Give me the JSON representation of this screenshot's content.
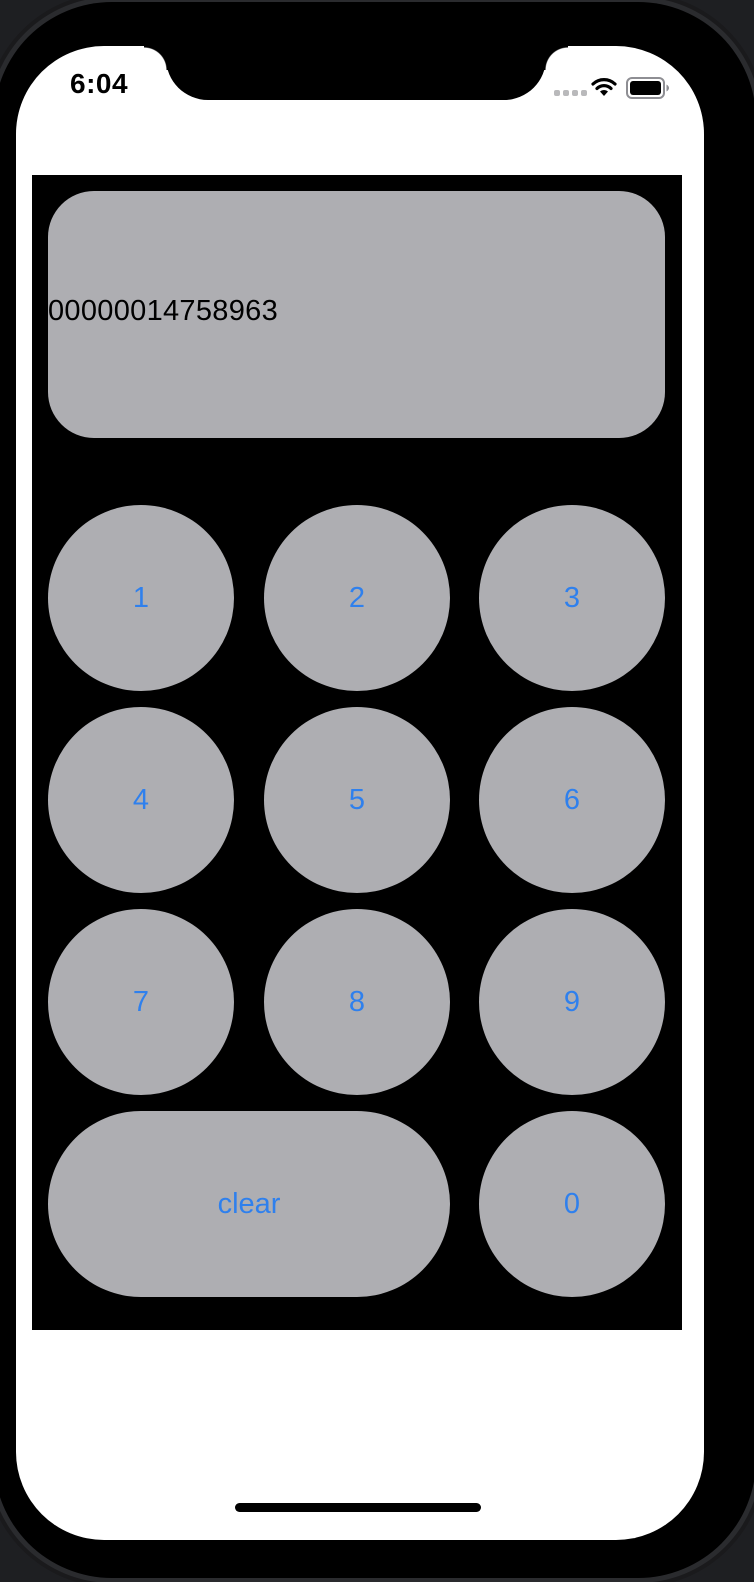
{
  "status_bar": {
    "time": "6:04"
  },
  "display": {
    "value": "00000014758963"
  },
  "keypad": {
    "keys": [
      "1",
      "2",
      "3",
      "4",
      "5",
      "6",
      "7",
      "8",
      "9"
    ],
    "clear_label": "clear",
    "zero_label": "0"
  },
  "colors": {
    "canvas": "#000000",
    "button_fill": "#aeaeb2",
    "button_text": "#2f80ed",
    "display_text": "#000000"
  }
}
